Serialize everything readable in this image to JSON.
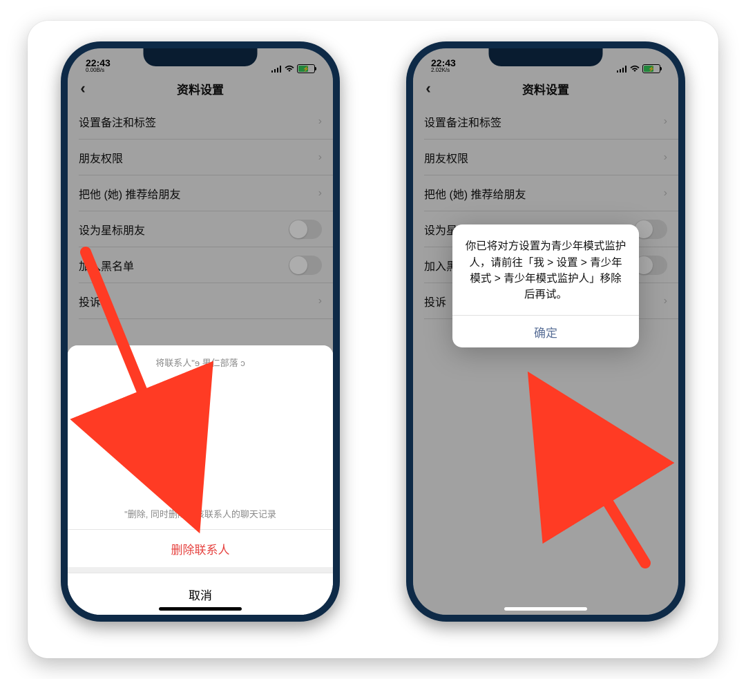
{
  "status": {
    "time": "22:43",
    "speed_left": "0.00B/s",
    "speed_right": "2.02K/s"
  },
  "nav": {
    "title": "资料设置"
  },
  "rows": {
    "remark": "设置备注和标签",
    "perm": "朋友权限",
    "recommend": "把他 (她) 推荐给朋友",
    "star": "设为星标朋友",
    "blacklist": "加入黑名单",
    "report": "投诉"
  },
  "sheet": {
    "line1": "将联系人\"ɘ 果仁部落 ɔ",
    "line2": "\"删除,  同时删除与该联系人的聊天记录",
    "delete": "删除联系人",
    "cancel": "取消"
  },
  "alert": {
    "msg": "你已将对方设置为青少年模式监护人，请前往「我 > 设置 > 青少年模式 > 青少年模式监护人」移除后再试。",
    "ok": "确定"
  }
}
